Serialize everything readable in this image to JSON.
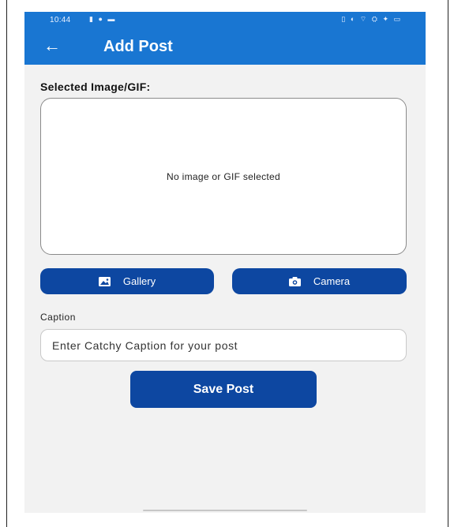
{
  "status_bar": {
    "time": "10:44",
    "left_icons": "▮ ● ▬",
    "right_icons": "▯ ◐ ⌔ ⛭ ✦ ▭"
  },
  "app_bar": {
    "back_icon": "arrow-left",
    "title": "Add Post",
    "background_color": "#1976d2"
  },
  "image_section": {
    "label": "Selected Image/GIF:",
    "empty_text": "No image or GIF selected"
  },
  "buttons": {
    "gallery_label": "Gallery",
    "gallery_icon": "image-icon",
    "camera_label": "Camera",
    "camera_icon": "camera-icon",
    "save_label": "Save Post",
    "accent_color": "#0d47a1"
  },
  "caption": {
    "label": "Caption",
    "value": "",
    "placeholder": "Enter Catchy Caption for your post"
  }
}
